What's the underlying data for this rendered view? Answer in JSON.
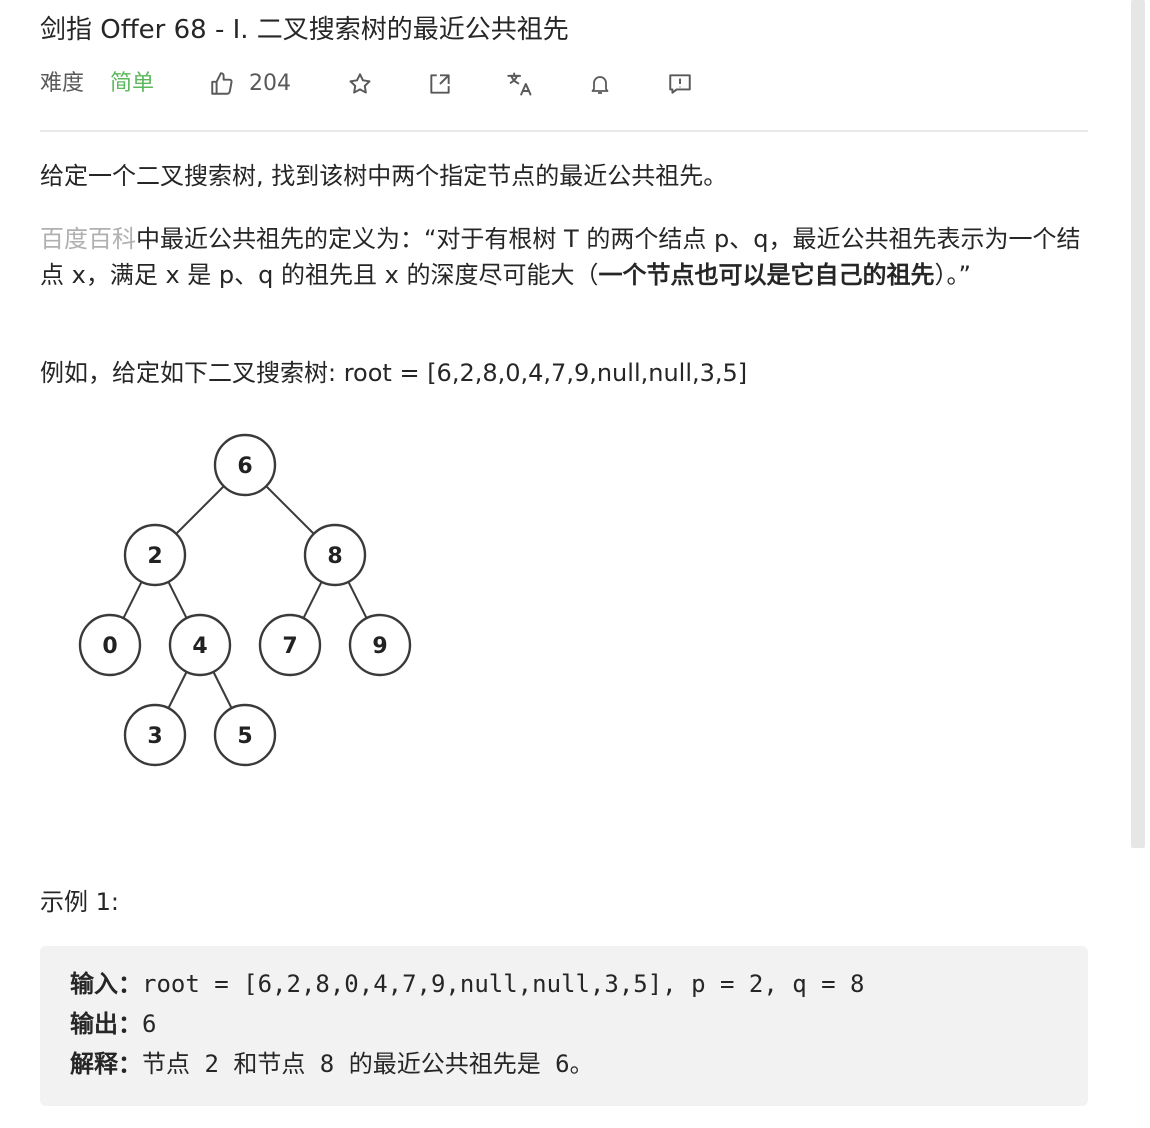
{
  "header": {
    "title": "剑指 Offer 68 - I. 二叉搜索树的最近公共祖先",
    "difficulty_label": "难度",
    "difficulty_value": "简单",
    "like_count": "204"
  },
  "icons": [
    "thumbs-up-icon",
    "star-icon",
    "share-icon",
    "translate-icon",
    "bell-icon",
    "feedback-icon"
  ],
  "colors": {
    "easy": "#5cb85c",
    "link": "#b0b0b0",
    "code_bg": "#f2f2f3"
  },
  "description": {
    "p1": "给定一个二叉搜索树, 找到该树中两个指定节点的最近公共祖先。",
    "p2_link": "百度百科",
    "p2_text_a": "中最近公共祖先的定义为：“对于有根树 T 的两个结点 p、q，最近公共祖先表示为一个结点 x，满足 x 是 p、q 的祖先且 x 的深度尽可能大（",
    "p2_bold": "一个节点也可以是它自己的祖先",
    "p2_text_b": "）。”",
    "p3": "例如，给定如下二叉搜索树:  root = [6,2,8,0,4,7,9,null,null,3,5]"
  },
  "tree": {
    "nodes": [
      "6",
      "2",
      "8",
      "0",
      "4",
      "7",
      "9",
      "3",
      "5"
    ]
  },
  "example": {
    "title": "示例 1:",
    "input_label": "输入：",
    "input_value": "root = [6,2,8,0,4,7,9,null,null,3,5], p = 2, q = 8",
    "output_label": "输出：",
    "output_value": "6",
    "explain_label": "解释：",
    "explain_value": "节点 2 和节点 8 的最近公共祖先是 6。"
  }
}
